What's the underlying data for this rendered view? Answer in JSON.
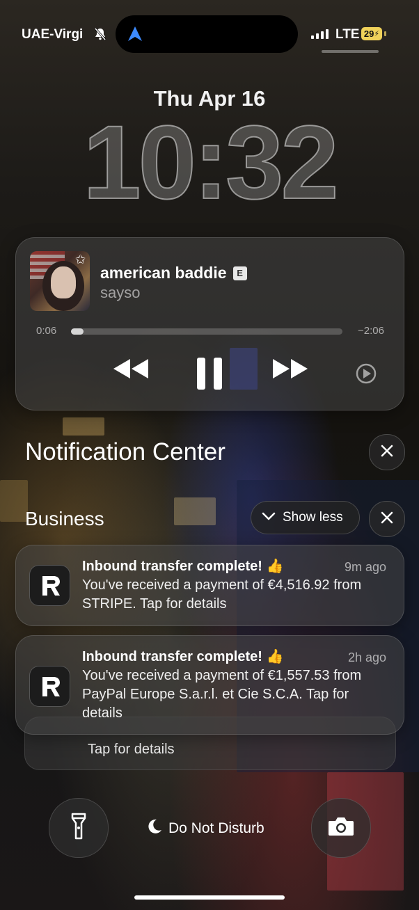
{
  "status_bar": {
    "carrier": "UAE-Virgi",
    "network": "LTE",
    "battery": "29"
  },
  "lock_screen": {
    "date": "Thu Apr 16",
    "time": "10:32"
  },
  "now_playing": {
    "title": "american baddie",
    "explicit_badge": "E",
    "artist": "sayso",
    "elapsed": "0:06",
    "remaining": "−2:06",
    "progress": 0.047
  },
  "notification_center": {
    "title": "Notification Center",
    "group": {
      "name": "Business",
      "show_less_label": "Show less"
    },
    "notifications": [
      {
        "title": "Inbound transfer complete! 👍",
        "time": "9m ago",
        "body": "You've received a payment of €4,516.92 from STRIPE. Tap for details"
      },
      {
        "title": "Inbound transfer complete! 👍",
        "time": "2h ago",
        "body": "You've received a payment of €1,557.53 from PayPal Europe S.a.r.l. et Cie S.C.A. Tap for details"
      }
    ],
    "stacked_preview": "Tap for details"
  },
  "bottom": {
    "dnd_label": "Do Not Disturb"
  },
  "icons": {
    "app": "revolut-icon",
    "flashlight": "flashlight-icon",
    "camera": "camera-icon",
    "navigation": "location-arrow-icon"
  }
}
